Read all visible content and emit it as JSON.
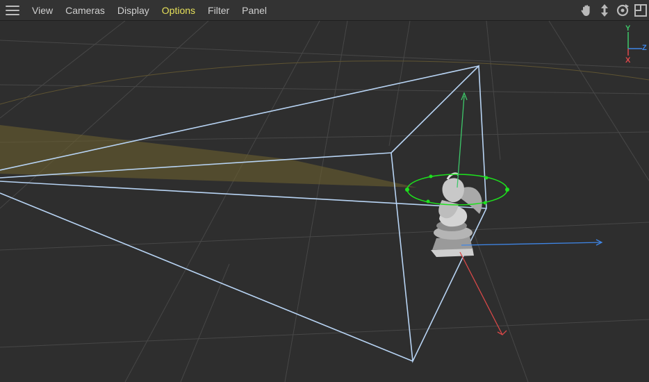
{
  "menubar": {
    "items": [
      {
        "label": "View",
        "active": false
      },
      {
        "label": "Cameras",
        "active": false
      },
      {
        "label": "Display",
        "active": false
      },
      {
        "label": "Options",
        "active": true
      },
      {
        "label": "Filter",
        "active": false
      },
      {
        "label": "Panel",
        "active": false
      }
    ],
    "nav_tools": [
      "hand-pan-icon",
      "move-vertical-icon",
      "orbit-rotate-icon",
      "maximize-view-icon"
    ]
  },
  "axis_widget": {
    "y_label": "Y",
    "z_label": "Z",
    "x_label": "X",
    "colors": {
      "x": "#e0484b",
      "y": "#3ec86a",
      "z": "#3f86e6"
    }
  },
  "scene": {
    "background": "#2e2e2e",
    "grid_color": "#474747",
    "frustum_color": "#b8d4f4",
    "light_cone_color": "#6b5f2e",
    "gizmo_ring_color": "#1ee01e",
    "object": "statue-model"
  }
}
